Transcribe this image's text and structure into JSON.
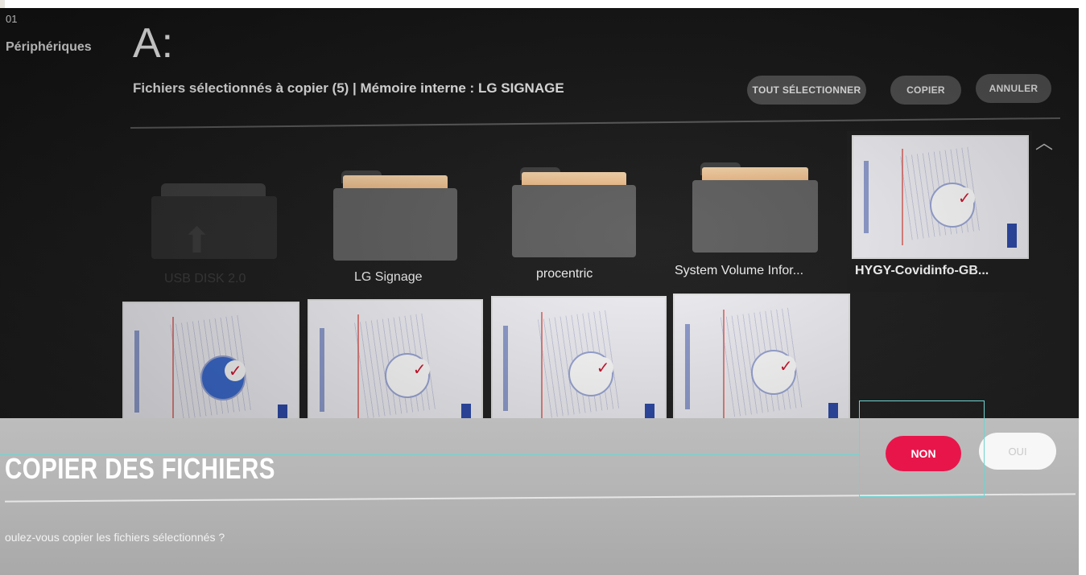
{
  "device": {
    "number": "01",
    "label": "Périphériques"
  },
  "drive": {
    "letter": "A:"
  },
  "header": {
    "subtitle": "Fichiers sélectionnés à copier (5) | Mémoire interne : LG SIGNAGE"
  },
  "toolbar": {
    "select_all": "TOUT SÉLECTIONNER",
    "copy": "COPIER",
    "cancel": "ANNULER"
  },
  "items": [
    {
      "name": "USB DISK 2.0",
      "type": "usb-drive",
      "dimmed": true
    },
    {
      "name": "LG Signage",
      "type": "folder"
    },
    {
      "name": "procentric",
      "type": "folder"
    },
    {
      "name": "System Volume Infor...",
      "type": "folder"
    },
    {
      "name": "HYGY-Covidinfo-GB...",
      "type": "image",
      "selected": true
    }
  ],
  "dialog": {
    "title": "COPIER DES FICHIERS",
    "question": "oulez-vous copier les fichiers sélectionnés ?",
    "no": "NON",
    "yes": "OUI"
  },
  "colors": {
    "accent": "#e8154b",
    "annotation": "#6fd3d3"
  }
}
